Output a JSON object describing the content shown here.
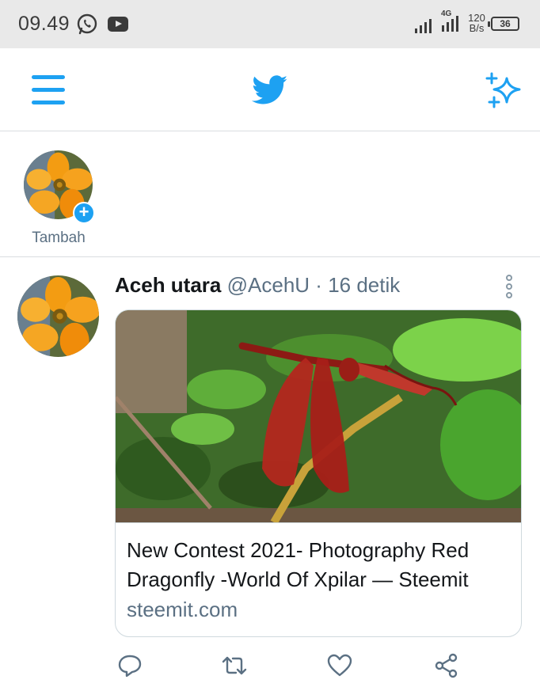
{
  "status_bar": {
    "time": "09.49",
    "network": "4G",
    "speed_value": "120",
    "speed_unit": "B/s",
    "battery": "36",
    "icons": [
      "whatsapp-icon",
      "youtube-icon",
      "signal-icon",
      "signal-4g-icon",
      "battery-icon"
    ]
  },
  "nav": {
    "icons": [
      "menu-icon",
      "twitter-bird-icon",
      "sparkle-icon"
    ],
    "accent_color": "#1da1f2"
  },
  "fleets": {
    "add_label": "Tambah"
  },
  "tweet": {
    "name": "Aceh utara",
    "handle": "@AcehU",
    "separator": "·",
    "time": "16 detik",
    "card": {
      "title": "New Contest 2021- Photography Red Dragonfly -World Of Xpilar — Steemit",
      "domain": "steemit.com"
    },
    "actions": [
      "reply-icon",
      "retweet-icon",
      "like-icon",
      "share-icon"
    ]
  }
}
